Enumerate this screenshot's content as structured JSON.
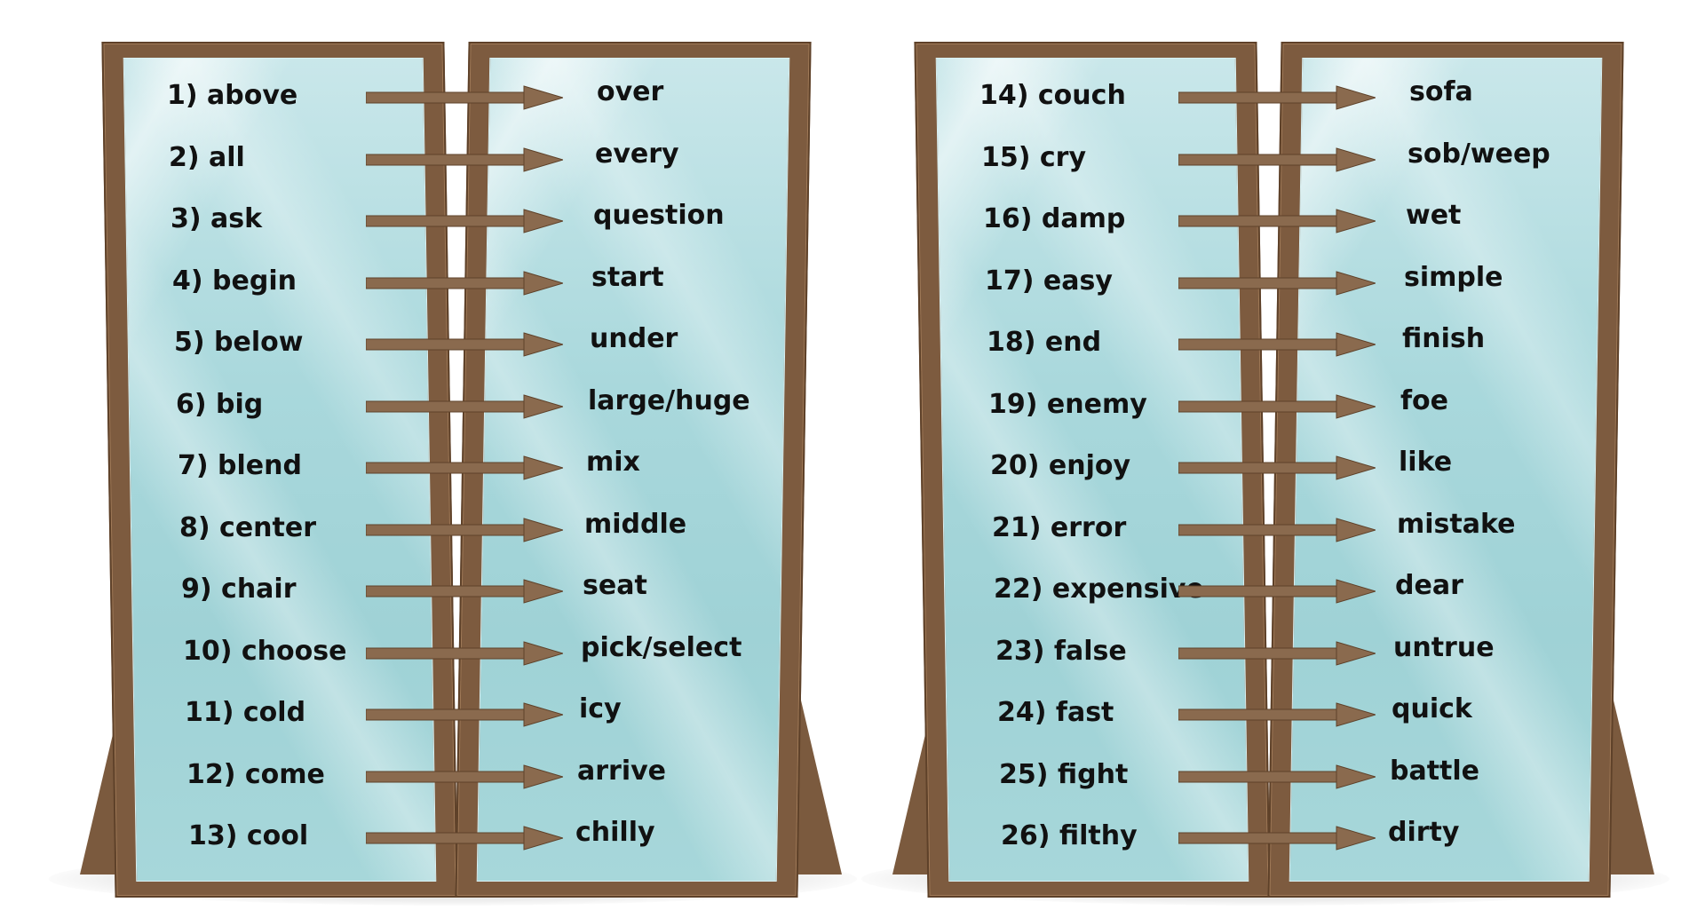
{
  "colors": {
    "frame": "#7d5b3f",
    "glass": "#a9d8dc",
    "arrow": "#8a6a4e",
    "text": "#111111"
  },
  "icons": {
    "arrow": "right-arrow-icon"
  },
  "groups": [
    {
      "pairs": [
        {
          "word": "1) above",
          "synonym": "over"
        },
        {
          "word": "2) all",
          "synonym": "every"
        },
        {
          "word": "3) ask",
          "synonym": "question"
        },
        {
          "word": "4) begin",
          "synonym": "start"
        },
        {
          "word": "5) below",
          "synonym": "under"
        },
        {
          "word": "6) big",
          "synonym": "large/huge"
        },
        {
          "word": "7) blend",
          "synonym": "mix"
        },
        {
          "word": "8) center",
          "synonym": "middle"
        },
        {
          "word": "9) chair",
          "synonym": "seat"
        },
        {
          "word": "10) choose",
          "synonym": "pick/select"
        },
        {
          "word": "11) cold",
          "synonym": "icy"
        },
        {
          "word": "12) come",
          "synonym": "arrive"
        },
        {
          "word": "13) cool",
          "synonym": "chilly"
        }
      ]
    },
    {
      "pairs": [
        {
          "word": "14) couch",
          "synonym": "sofa"
        },
        {
          "word": "15) cry",
          "synonym": "sob/weep"
        },
        {
          "word": "16) damp",
          "synonym": "wet"
        },
        {
          "word": "17) easy",
          "synonym": "simple"
        },
        {
          "word": "18) end",
          "synonym": "finish"
        },
        {
          "word": "19) enemy",
          "synonym": "foe"
        },
        {
          "word": "20) enjoy",
          "synonym": "like"
        },
        {
          "word": "21) error",
          "synonym": "mistake"
        },
        {
          "word": "22) expensive",
          "synonym": "dear"
        },
        {
          "word": "23) false",
          "synonym": "untrue"
        },
        {
          "word": "24) fast",
          "synonym": "quick"
        },
        {
          "word": "25) fight",
          "synonym": "battle"
        },
        {
          "word": "26) filthy",
          "synonym": "dirty"
        }
      ]
    }
  ]
}
